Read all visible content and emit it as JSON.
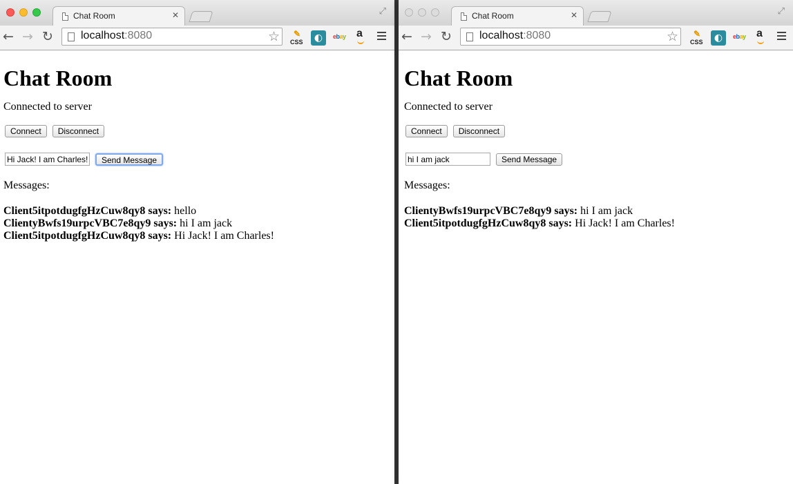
{
  "windows": [
    {
      "active": true,
      "tab_title": "Chat Room",
      "url_host": "localhost",
      "url_port": ":8080",
      "page": {
        "heading": "Chat Room",
        "status": "Connected to server",
        "connect_label": "Connect",
        "disconnect_label": "Disconnect",
        "message_input_value": "Hi Jack! I am Charles!",
        "send_label": "Send Message",
        "messages_label": "Messages:",
        "messages": [
          {
            "sender": "Client5itpotdugfgHzCuw8qy8 says:",
            "text": " hello"
          },
          {
            "sender": "ClientyBwfs19urpcVBC7e8qy9 says:",
            "text": " hi I am jack"
          },
          {
            "sender": "Client5itpotdugfgHzCuw8qy8 says:",
            "text": " Hi Jack! I am Charles!"
          }
        ]
      }
    },
    {
      "active": false,
      "tab_title": "Chat Room",
      "url_host": "localhost",
      "url_port": ":8080",
      "page": {
        "heading": "Chat Room",
        "status": "Connected to server",
        "connect_label": "Connect",
        "disconnect_label": "Disconnect",
        "message_input_value": "hi I am jack",
        "send_label": "Send Message",
        "messages_label": "Messages:",
        "messages": [
          {
            "sender": "ClientyBwfs19urpcVBC7e8qy9 says:",
            "text": " hi I am jack"
          },
          {
            "sender": "Client5itpotdugfgHzCuw8qy8 says:",
            "text": " Hi Jack! I am Charles!"
          }
        ]
      }
    }
  ],
  "extensions": {
    "css_label": "CSS",
    "ebay_letters": [
      "e",
      "b",
      "a",
      "y"
    ],
    "amazon_label": "a"
  },
  "colors": {
    "close": "#fc5b57",
    "minimize": "#fcbc2e",
    "maximize": "#35c84a",
    "focus_ring": "#7fa9e8"
  }
}
